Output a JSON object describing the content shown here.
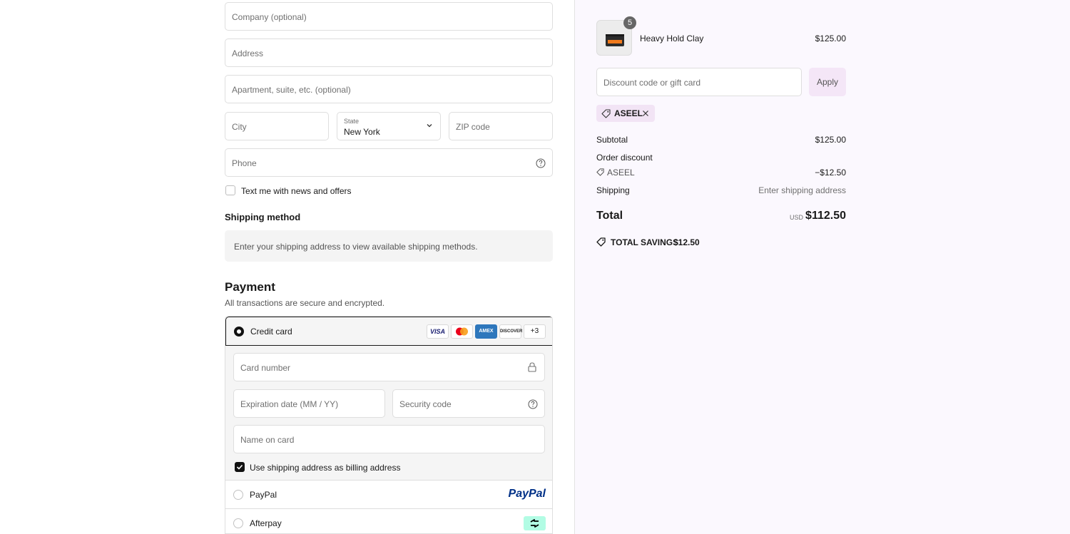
{
  "form": {
    "company_ph": "Company (optional)",
    "address_ph": "Address",
    "apartment_ph": "Apartment, suite, etc. (optional)",
    "city_ph": "City",
    "state_label": "State",
    "state_value": "New York",
    "zip_ph": "ZIP code",
    "phone_ph": "Phone",
    "sms_label": "Text me with news and offers",
    "sms_checked": false
  },
  "shipping": {
    "title": "Shipping method",
    "message": "Enter your shipping address to view available shipping methods."
  },
  "payment": {
    "title": "Payment",
    "subtitle": "All transactions are secure and encrypted.",
    "credit_card_label": "Credit card",
    "card_badges": [
      "VISA",
      "MC",
      "AMEX",
      "DISCOVER",
      "+3"
    ],
    "card_number_ph": "Card number",
    "expiry_ph": "Expiration date (MM / YY)",
    "security_ph": "Security code",
    "name_ph": "Name on card",
    "billing_label": "Use shipping address as billing address",
    "billing_checked": true,
    "paypal_label": "PayPal",
    "paypal_logo": "PayPal",
    "afterpay_label": "Afterpay"
  },
  "summary": {
    "product_name": "Heavy Hold Clay",
    "product_qty": "5",
    "product_price": "$125.00",
    "discount_ph": "Discount code or gift card",
    "apply_label": "Apply",
    "applied_code": "ASEEL",
    "subtotal_label": "Subtotal",
    "subtotal_value": "$125.00",
    "order_discount_label": "Order discount",
    "discount_code": "ASEEL",
    "discount_value": "−$12.50",
    "shipping_label": "Shipping",
    "shipping_value": "Enter shipping address",
    "total_label": "Total",
    "currency": "USD",
    "total_value": "$112.50",
    "savings_label": "TOTAL SAVINGS",
    "savings_value": "$12.50"
  },
  "colors": {
    "accent_bg": "#f4e6f7",
    "summary_bg": "#fbf8fe",
    "paypal_blue": "#003087",
    "paypal_light": "#009cde",
    "afterpay_mint": "#b2fce4"
  }
}
